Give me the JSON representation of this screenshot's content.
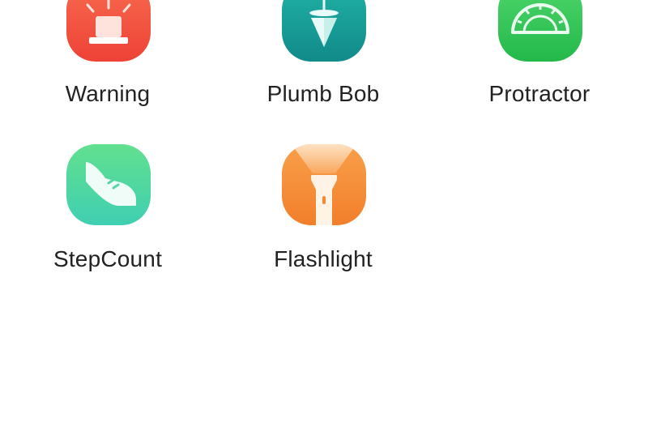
{
  "apps": [
    {
      "label": "Warning",
      "icon": "siren-icon",
      "color": "#F2533D"
    },
    {
      "label": "Plumb Bob",
      "icon": "plumb-bob-icon",
      "color": "#1A9E96"
    },
    {
      "label": "Protractor",
      "icon": "protractor-icon",
      "color": "#34C655"
    },
    {
      "label": "StepCount",
      "icon": "sneaker-icon",
      "color": "#4FD8A0"
    },
    {
      "label": "Flashlight",
      "icon": "flashlight-icon",
      "color": "#F58A2E"
    }
  ]
}
